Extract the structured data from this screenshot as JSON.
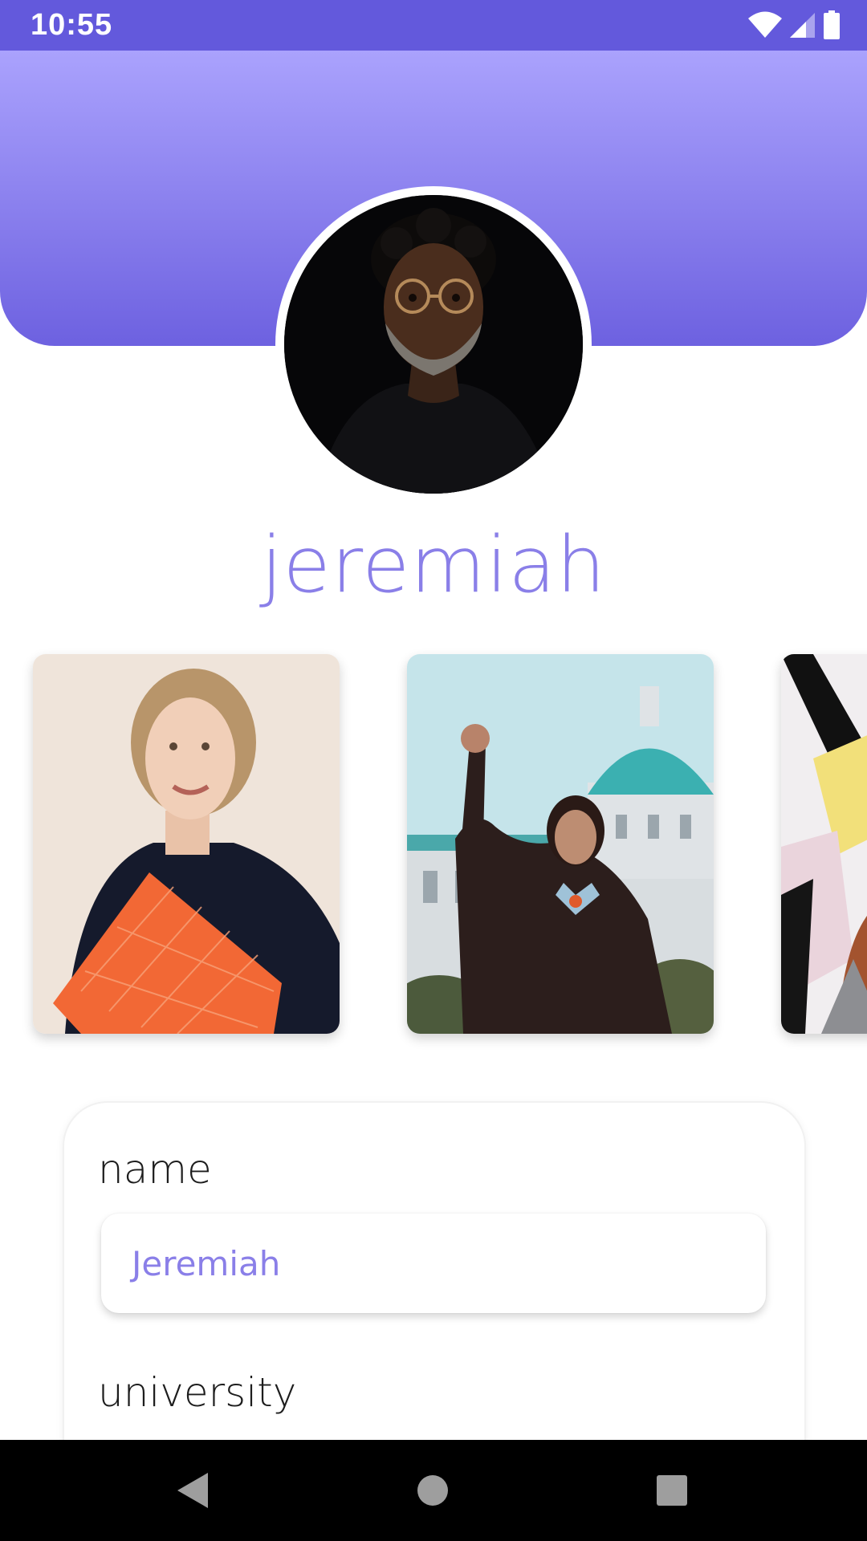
{
  "status_bar": {
    "time": "10:55",
    "icons": [
      "wifi-icon",
      "cellular-signal-icon",
      "battery-icon"
    ]
  },
  "profile": {
    "display_name": "jeremiah",
    "avatar_icon": "profile-photo"
  },
  "photos": [
    {
      "name": "photo-card-woman-with-folder"
    },
    {
      "name": "photo-card-graduate"
    },
    {
      "name": "photo-card-partial"
    }
  ],
  "form": {
    "name_label": "name",
    "name_value": "Jeremiah",
    "university_label": "university"
  },
  "nav": {
    "back": "back-icon",
    "home": "home-icon",
    "recents": "recents-icon"
  },
  "colors": {
    "status_bar": "#6359dc",
    "header_top": "#aaa2fd",
    "header_bottom": "#6d61e0",
    "accent_text": "#8a7fe8"
  }
}
